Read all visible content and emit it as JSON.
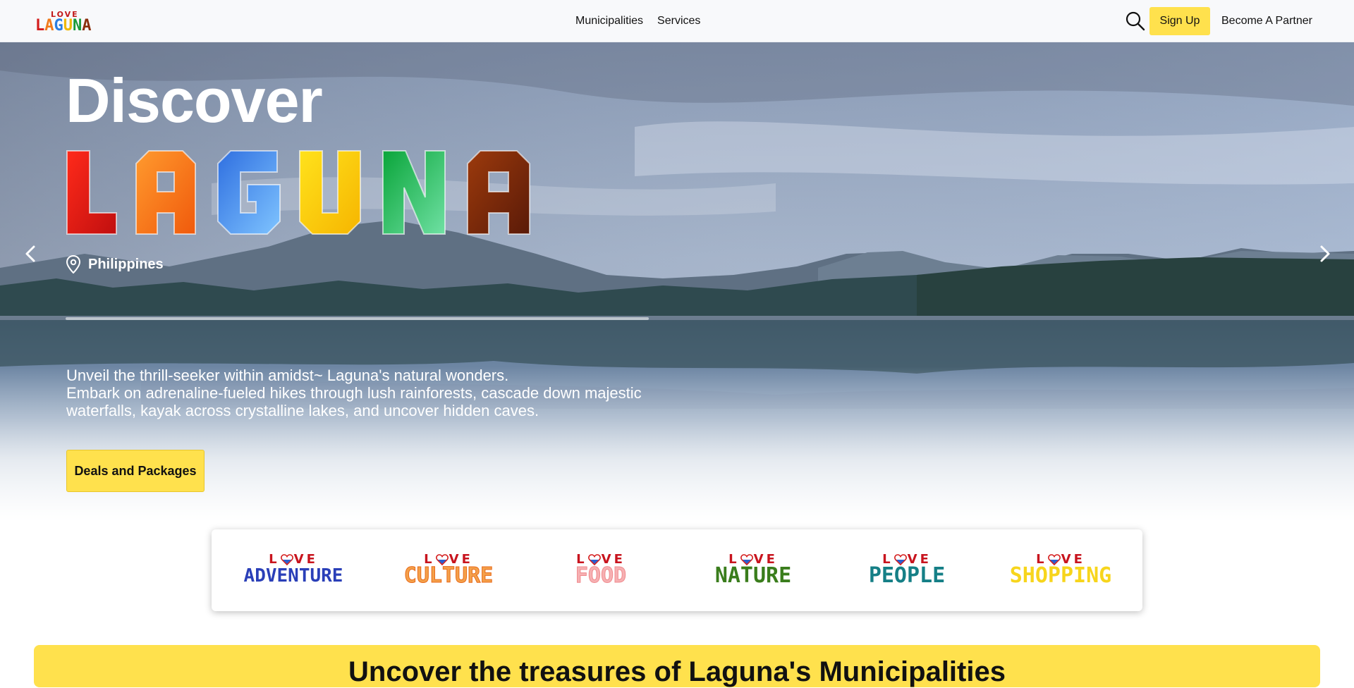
{
  "navbar": {
    "logo": {
      "love": "LOVE",
      "word": "LAGUNA"
    },
    "links": [
      "Municipalities",
      "Services"
    ],
    "search_icon": "search-icon",
    "signup_label": "Sign Up",
    "partner_label": "Become A Partner"
  },
  "hero": {
    "discover": "Discover",
    "laguna": "LAGUNA",
    "location": "Philippines",
    "location_icon": "map-pin-icon",
    "tagline_line1": "Unveil the thrill-seeker within amidst~ Laguna's natural wonders.",
    "tagline_line2": "Embark on adrenaline-fueled hikes through lush rainforests, cascade down majestic waterfalls, kayak across crystalline lakes, and uncover hidden caves.",
    "cta_label": "Deals and Packages",
    "prev_icon": "chevron-left-icon",
    "next_icon": "chevron-right-icon"
  },
  "categories": [
    {
      "love": "LOVE",
      "word": "ADVENTURE",
      "color": "#2a3fb8"
    },
    {
      "love": "LOVE",
      "word": "CULTURE",
      "color": "#f07a2a"
    },
    {
      "love": "LOVE",
      "word": "FOOD",
      "color": "#f08a8e"
    },
    {
      "love": "LOVE",
      "word": "NATURE",
      "color": "#3a7d1c"
    },
    {
      "love": "LOVE",
      "word": "PEOPLE",
      "color": "#157f86"
    },
    {
      "love": "LOVE",
      "word": "SHOPPING",
      "color": "#f7d51c"
    }
  ],
  "banner": {
    "title": "Uncover the treasures of Laguna's Municipalities"
  },
  "colors": {
    "accent_yellow": "#ffe14d",
    "nav_bg": "#f8f9fb"
  }
}
